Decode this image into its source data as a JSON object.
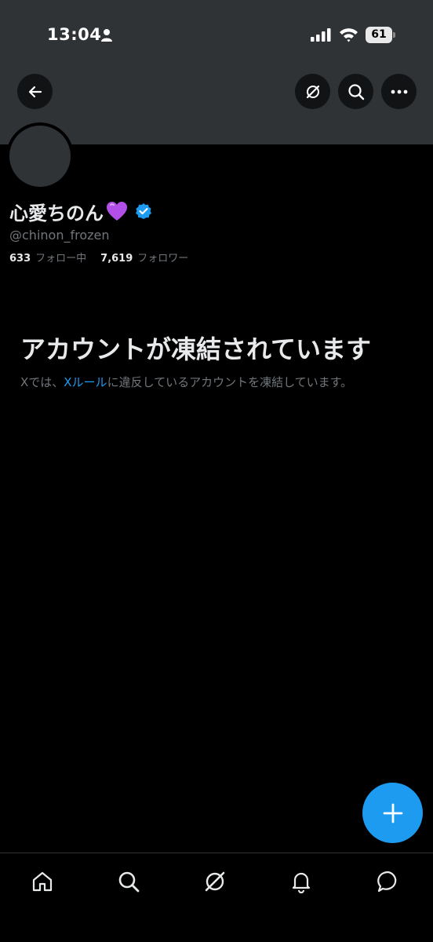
{
  "status_bar": {
    "time": "13:04",
    "battery": "61"
  },
  "header": {
    "back_icon": "arrow-left-icon",
    "grok_icon": "grok-icon",
    "search_icon": "search-icon",
    "more_icon": "more-horizontal-icon"
  },
  "profile": {
    "display_name": "心愛ちのん",
    "emoji": "purple-heart",
    "handle": "@chinon_frozen",
    "following_count": "633",
    "following_label": "フォロー中",
    "followers_count": "7,619",
    "followers_label": "フォロワー"
  },
  "suspended": {
    "title": "アカウントが凍結されています",
    "desc_prefix": "Xでは、",
    "desc_link": "Xルール",
    "desc_suffix": "に違反しているアカウントを凍結しています。"
  },
  "colors": {
    "accent": "#1d9bf0",
    "banner": "#2f3336",
    "background": "#000000",
    "secondary_text": "#71767b",
    "heart": "#b24fe8"
  },
  "bottom_nav": [
    "home-icon",
    "search-icon",
    "grok-icon",
    "notifications-icon",
    "messages-icon"
  ]
}
